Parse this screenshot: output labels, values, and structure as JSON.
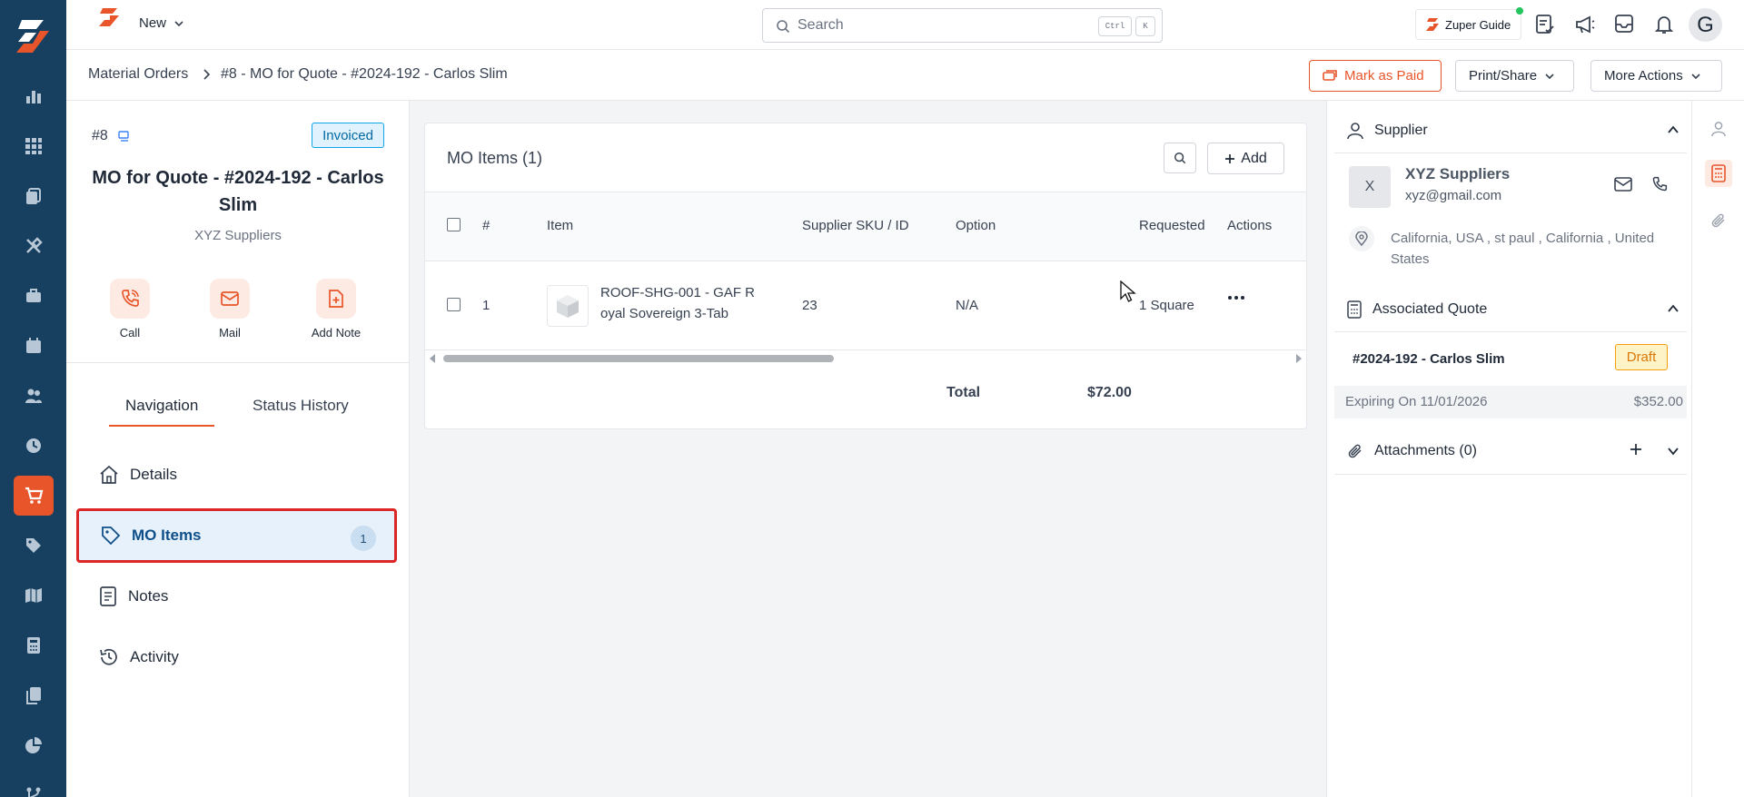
{
  "topbar": {
    "new_label": "New",
    "search_placeholder": "Search",
    "kbd_ctrl": "Ctrl",
    "kbd_k": "K",
    "guide_label": "Zuper Guide",
    "avatar_letter": "G"
  },
  "breadcrumb": {
    "parent": "Material Orders",
    "current": "#8 - MO for Quote - #2024-192 - Carlos Slim"
  },
  "header_actions": {
    "mark_paid": "Mark as Paid",
    "print_share": "Print/Share",
    "more_actions": "More Actions"
  },
  "order": {
    "number": "#8",
    "status": "Invoiced",
    "title": "MO for Quote - #2024-192 - Carlos Slim",
    "supplier": "XYZ Suppliers",
    "actions": [
      "Call",
      "Mail",
      "Add Note"
    ]
  },
  "tabs": [
    "Navigation",
    "Status History"
  ],
  "nav": {
    "details": "Details",
    "mo_items": "MO Items",
    "mo_items_count": "1",
    "notes": "Notes",
    "activity": "Activity"
  },
  "items_card": {
    "title": "MO Items (1)",
    "add_label": "Add",
    "columns": [
      "#",
      "Item",
      "Supplier SKU / ID",
      "Option",
      "Requested",
      "Actions"
    ],
    "rows": [
      {
        "index": "1",
        "item_line1": "ROOF-SHG-001 - GAF R",
        "item_line2": "oyal Sovereign 3-Tab",
        "sku": "23",
        "option": "N/A",
        "requested": "1 Square"
      }
    ],
    "total_label": "Total",
    "total_value": "$72.00"
  },
  "supplier_panel": {
    "heading": "Supplier",
    "avatar_letter": "X",
    "name": "XYZ Suppliers",
    "email": "xyz@gmail.com",
    "address": "California, USA , st paul , California , United States"
  },
  "quote_panel": {
    "heading": "Associated Quote",
    "quote_id": "#2024-192 - Carlos Slim",
    "status": "Draft",
    "expiring": "Expiring On 11/01/2026",
    "amount": "$352.00"
  },
  "attachments_panel": {
    "heading": "Attachments (0)"
  },
  "colors": {
    "brand": "#e8552a",
    "rail": "#173f5f",
    "highlight_border": "#dc2626"
  }
}
